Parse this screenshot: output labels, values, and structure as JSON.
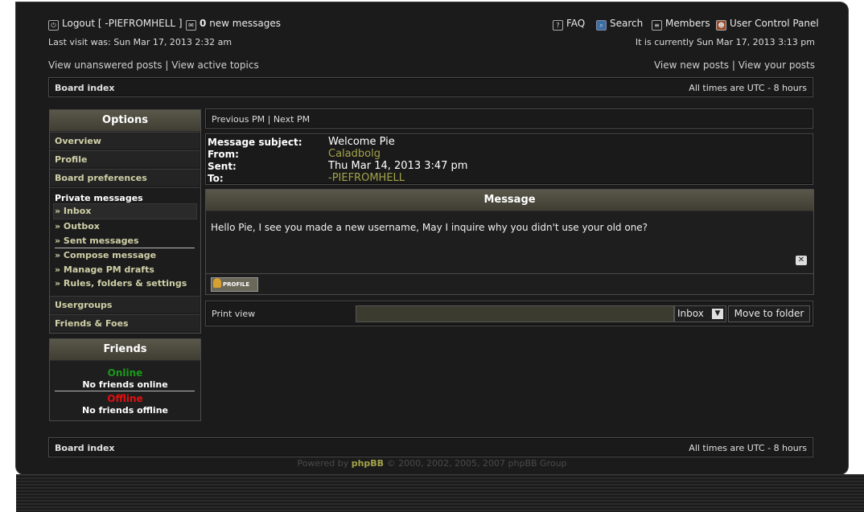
{
  "header": {
    "logout": "Logout [ -PIEFROMHELL ]",
    "new_messages_count": "0",
    "new_messages_label": "new messages",
    "faq": "FAQ",
    "search": "Search",
    "members": "Members",
    "ucp": "User Control Panel",
    "last_visit": "Last visit was: Sun Mar 17, 2013 2:32 am",
    "current_time": "It is currently Sun Mar 17, 2013 3:13 pm",
    "view_unanswered": "View unanswered posts",
    "view_active": "View active topics",
    "view_new": "View new posts",
    "view_your": "View your posts",
    "separator": "|"
  },
  "breadcrumb": {
    "board_index": "Board index",
    "timezone": "All times are UTC - 8 hours"
  },
  "sidebar": {
    "options_title": "Options",
    "overview": "Overview",
    "profile": "Profile",
    "board_prefs": "Board preferences",
    "private_messages": "Private messages",
    "pm_items": [
      "» Inbox",
      "» Outbox",
      "» Sent messages",
      "» Compose message",
      "» Manage PM drafts",
      "» Rules, folders & settings"
    ],
    "usergroups": "Usergroups",
    "friends_foes": "Friends & Foes",
    "friends_title": "Friends",
    "online": "Online",
    "no_online": "No friends online",
    "offline": "Offline",
    "no_offline": "No friends offline"
  },
  "pm_nav": {
    "prev": "Previous PM",
    "next": "Next PM"
  },
  "message": {
    "subject_label": "Message subject:",
    "subject": "Welcome Pie",
    "from_label": "From:",
    "from": "Caladbolg",
    "sent_label": "Sent:",
    "sent": "Thu Mar 14, 2013 3:47 pm",
    "to_label": "To:",
    "to": "-PIEFROMHELL",
    "panel_title": "Message",
    "body": "Hello Pie, I see you made a new username, May I inquire why you didn't use your old one?",
    "profile_btn": "PROFILE"
  },
  "actions": {
    "print_view": "Print view",
    "folder_select": "Inbox",
    "move_btn": "Move to folder"
  },
  "footer": {
    "powered_prefix": "Powered by",
    "powered_brand": "phpBB",
    "powered_suffix": "© 2000, 2002, 2005, 2007 phpBB Group"
  },
  "colors": {
    "online": "#1a9a1a",
    "offline": "#e01010",
    "accent_gold": "#a4a44a"
  }
}
